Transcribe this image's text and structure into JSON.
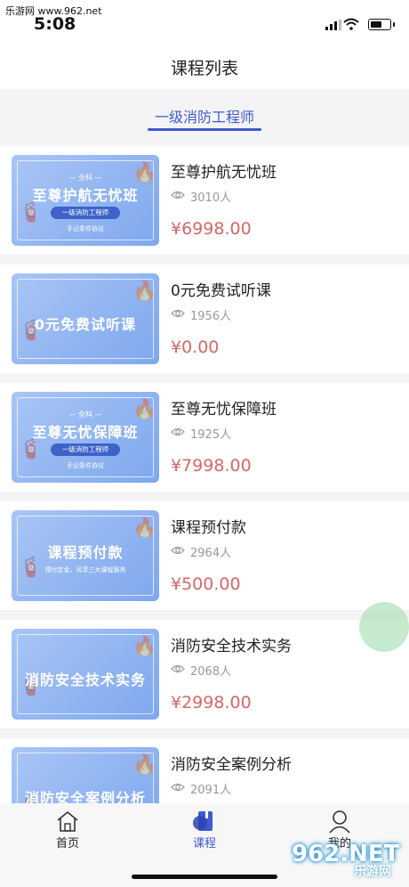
{
  "status_bar": {
    "watermark": "乐游网 www.962.net",
    "time": "5:08"
  },
  "header": {
    "title": "课程列表"
  },
  "tabs": [
    {
      "label": "一级消防工程师",
      "active": true
    }
  ],
  "colors": {
    "accent": "#3f5bd0",
    "price": "#d96666",
    "thumb": "#8fb3f2"
  },
  "courses": [
    {
      "title": "至尊护航无忧班",
      "views": "3010人",
      "price": "¥6998.00",
      "thumb": {
        "small": "— 全科 —",
        "title": "至尊护航无忧班",
        "pill": "一级消防工程师",
        "foot": "手记条件协议"
      }
    },
    {
      "title": "0元免费试听课",
      "views": "1956人",
      "price": "¥0.00",
      "thumb": {
        "small": "",
        "title": "0元免费试听课",
        "pill": "",
        "foot": ""
      }
    },
    {
      "title": "至尊无忧保障班",
      "views": "1925人",
      "price": "¥7998.00",
      "thumb": {
        "small": "— 全科 —",
        "title": "至尊无忧保障班",
        "pill": "一级消防工程师",
        "foot": "手记条件协议"
      }
    },
    {
      "title": "课程预付款",
      "views": "2964人",
      "price": "¥500.00",
      "thumb": {
        "small": "",
        "title": "课程预付款",
        "pill": "",
        "foot": "预付定金，另享三大课程服务"
      }
    },
    {
      "title": "消防安全技术实务",
      "views": "2068人",
      "price": "¥2998.00",
      "thumb": {
        "small": "",
        "title": "消防安全技术实务",
        "pill": "",
        "foot": ""
      }
    },
    {
      "title": "消防安全案例分析",
      "views": "2091人",
      "price": "",
      "thumb": {
        "small": "",
        "title": "消防安全案例分析",
        "pill": "",
        "foot": ""
      }
    }
  ],
  "bottom_nav": [
    {
      "label": "首页",
      "icon": "home-icon",
      "active": false
    },
    {
      "label": "课程",
      "icon": "book-icon",
      "active": true
    },
    {
      "label": "我的",
      "icon": "user-icon",
      "active": false
    }
  ],
  "watermark_logo": {
    "main": "962.NET",
    "sub": "乐游网"
  }
}
